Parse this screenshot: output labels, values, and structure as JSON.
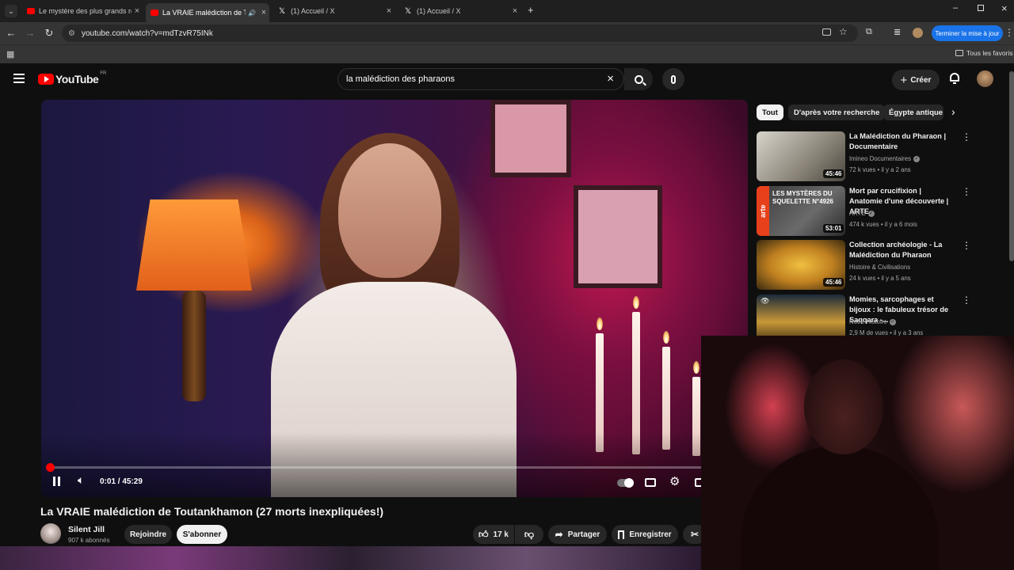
{
  "browser": {
    "tabs": [
      {
        "title": "Le mystère des plus grands rés",
        "favicon_color": "#ff0000",
        "active": false
      },
      {
        "title": "La VRAIE malédiction de Tou",
        "favicon_color": "#ff0000",
        "active": true
      },
      {
        "title": "(1) Accueil / X",
        "favicon_color": "#ffffff",
        "active": false
      },
      {
        "title": "(1) Accueil / X",
        "favicon_color": "#ffffff",
        "active": false
      }
    ],
    "url": "youtube.com/watch?v=mdTzvR75INk",
    "update_button": "Terminer la mise à jour",
    "all_favorites": "Tous les favoris"
  },
  "youtube": {
    "logo_text": "YouTube",
    "region": "FR",
    "search_value": "la malédiction des pharaons",
    "create_label": "Créer",
    "brand_color": "#ff0000"
  },
  "video": {
    "time_current": "0:01",
    "time_total": "45:29",
    "time_display": "0:01 / 45:29",
    "title": "La VRAIE malédiction de Toutankhamon (27 morts inexpliquées!)",
    "channel": "Silent Jill",
    "subscribers": "907 k abonnés",
    "join_label": "Rejoindre",
    "subscribe_label": "S'abonner",
    "likes": "17 k",
    "share_label": "Partager",
    "save_label": "Enregistrer"
  },
  "chips": [
    "Tout",
    "D'après votre recherche",
    "Égypte antique"
  ],
  "recommendations": [
    {
      "title": "La Malédiction du Pharaon | Documentaire",
      "channel": "Imineo Documentaires",
      "meta": "72 k vues • il y a 2 ans",
      "duration": "45:46"
    },
    {
      "title": "Mort par crucifixion | Anatomie d'une découverte | ARTE",
      "channel": "ARTE",
      "meta": "474 k vues • il y a 6 mois",
      "duration": "53:01",
      "thumb_text": "LES MYSTÈRES DU SQUELETTE N°4926",
      "thumb_brand": "arte"
    },
    {
      "title": "Collection archéologie - La Malédiction du Pharaon",
      "channel": "Histoire & Civilisations",
      "meta": "24 k vues • il y a 5 ans",
      "duration": "45:46"
    },
    {
      "title": "Momies, sarcophages et bijoux : le fabuleux trésor de Saqqara -...",
      "channel": "Notre Histoire",
      "meta": "2,9 M de vues • il y a 3 ans",
      "duration": ""
    }
  ]
}
